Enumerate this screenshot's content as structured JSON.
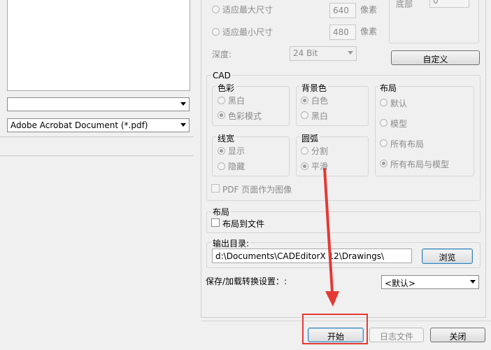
{
  "image_size": {
    "max_label": "适应最大尺寸",
    "max_value": "640",
    "max_unit": "像素",
    "min_label": "适应最小尺寸",
    "min_value": "480",
    "min_unit": "像素",
    "depth_label": "深度:",
    "depth_value": "24 Bit",
    "bottom_label": "底部",
    "bottom_value": "0",
    "custom_button": "自定义"
  },
  "left": {
    "format_select": "",
    "file_type_select": "Adobe Acrobat Document (*.pdf)"
  },
  "cad": {
    "title": "CAD",
    "color": {
      "title": "色彩",
      "options": [
        "黑白",
        "色彩模式"
      ],
      "selected": 1
    },
    "background": {
      "title": "背景色",
      "options": [
        "白色",
        "黑白"
      ],
      "selected": 0
    },
    "layout": {
      "title": "布局",
      "options": [
        "默认",
        "模型",
        "所有布局",
        "所有布局与模型"
      ],
      "selected": 3
    },
    "lineweight": {
      "title": "线宽",
      "options": [
        "显示",
        "隐藏"
      ],
      "selected": 0
    },
    "arc": {
      "title": "圆弧",
      "options": [
        "分割",
        "平滑"
      ],
      "selected": 1
    },
    "pdf_as_image": "PDF 页面作为图像"
  },
  "layout_section": {
    "title": "布局",
    "checkbox_label": "布局到文件"
  },
  "output": {
    "title": "输出目录:",
    "path": "d:\\Documents\\CADEditorX 12\\Drawings\\",
    "browse_button": "浏览"
  },
  "settings": {
    "label": "保存/加载转换设置：:",
    "value": "<默认>"
  },
  "footer": {
    "start_button": "开始",
    "log_button": "日志文件",
    "close_button": "关闭"
  },
  "colors": {
    "highlight": "#e53935"
  }
}
